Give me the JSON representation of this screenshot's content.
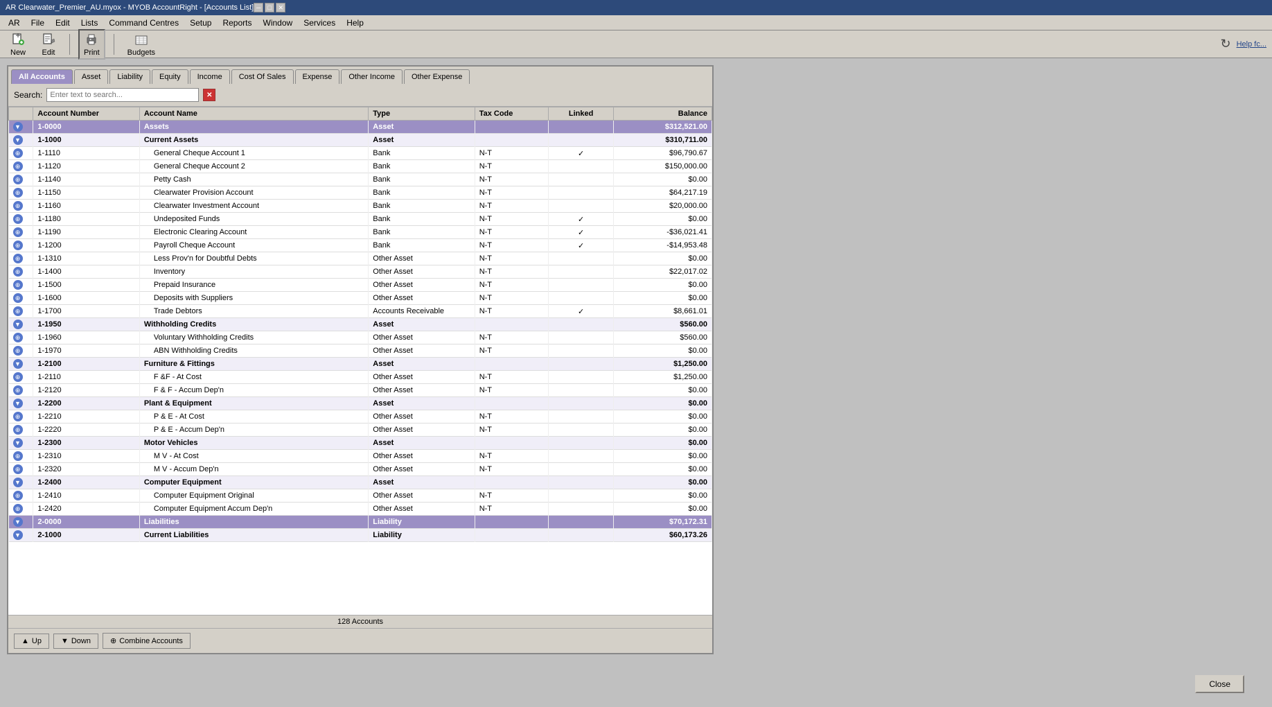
{
  "window": {
    "title": "AR Clearwater_Premier_AU.myox - MYOB AccountRight - [Accounts List]",
    "close_btn": "✕",
    "min_btn": "─",
    "max_btn": "□"
  },
  "menu": {
    "items": [
      "AR",
      "File",
      "Edit",
      "Lists",
      "Command Centres",
      "Setup",
      "Reports",
      "Window",
      "Services",
      "Help"
    ]
  },
  "toolbar": {
    "new_label": "New",
    "edit_label": "Edit",
    "print_label": "Print",
    "budgets_label": "Budgets"
  },
  "tabs": {
    "all_accounts": "All Accounts",
    "asset": "Asset",
    "liability": "Liability",
    "equity": "Equity",
    "income": "Income",
    "cost_of_sales": "Cost Of Sales",
    "expense": "Expense",
    "other_income": "Other Income",
    "other_expense": "Other Expense"
  },
  "search": {
    "label": "Search:",
    "placeholder": "Enter text to search..."
  },
  "table": {
    "headers": [
      "Account Number",
      "Account Name",
      "Type",
      "Tax Code",
      "Linked",
      "Balance"
    ],
    "rows": [
      {
        "num": "1-0000",
        "name": "Assets",
        "type": "Asset",
        "tax": "",
        "linked": "",
        "balance": "$312,521.00",
        "level": "group"
      },
      {
        "num": "1-1000",
        "name": "Current Assets",
        "type": "Asset",
        "tax": "",
        "linked": "",
        "balance": "$310,711.00",
        "level": "subgroup"
      },
      {
        "num": "1-1110",
        "name": "General Cheque Account 1",
        "type": "Bank",
        "tax": "N-T",
        "linked": "✓",
        "balance": "$96,790.67",
        "level": "item"
      },
      {
        "num": "1-1120",
        "name": "General Cheque Account 2",
        "type": "Bank",
        "tax": "N-T",
        "linked": "",
        "balance": "$150,000.00",
        "level": "item"
      },
      {
        "num": "1-1140",
        "name": "Petty Cash",
        "type": "Bank",
        "tax": "N-T",
        "linked": "",
        "balance": "$0.00",
        "level": "item"
      },
      {
        "num": "1-1150",
        "name": "Clearwater Provision Account",
        "type": "Bank",
        "tax": "N-T",
        "linked": "",
        "balance": "$64,217.19",
        "level": "item"
      },
      {
        "num": "1-1160",
        "name": "Clearwater Investment Account",
        "type": "Bank",
        "tax": "N-T",
        "linked": "",
        "balance": "$20,000.00",
        "level": "item"
      },
      {
        "num": "1-1180",
        "name": "Undeposited Funds",
        "type": "Bank",
        "tax": "N-T",
        "linked": "✓",
        "balance": "$0.00",
        "level": "item"
      },
      {
        "num": "1-1190",
        "name": "Electronic Clearing Account",
        "type": "Bank",
        "tax": "N-T",
        "linked": "✓",
        "balance": "-$36,021.41",
        "level": "item"
      },
      {
        "num": "1-1200",
        "name": "Payroll Cheque Account",
        "type": "Bank",
        "tax": "N-T",
        "linked": "✓",
        "balance": "-$14,953.48",
        "level": "item"
      },
      {
        "num": "1-1310",
        "name": "Less Prov'n for Doubtful Debts",
        "type": "Other Asset",
        "tax": "N-T",
        "linked": "",
        "balance": "$0.00",
        "level": "item"
      },
      {
        "num": "1-1400",
        "name": "Inventory",
        "type": "Other Asset",
        "tax": "N-T",
        "linked": "",
        "balance": "$22,017.02",
        "level": "item"
      },
      {
        "num": "1-1500",
        "name": "Prepaid Insurance",
        "type": "Other Asset",
        "tax": "N-T",
        "linked": "",
        "balance": "$0.00",
        "level": "item"
      },
      {
        "num": "1-1600",
        "name": "Deposits with Suppliers",
        "type": "Other Asset",
        "tax": "N-T",
        "linked": "",
        "balance": "$0.00",
        "level": "item"
      },
      {
        "num": "1-1700",
        "name": "Trade Debtors",
        "type": "Accounts Receivable",
        "tax": "N-T",
        "linked": "✓",
        "balance": "$8,661.01",
        "level": "item"
      },
      {
        "num": "1-1950",
        "name": "Withholding Credits",
        "type": "Asset",
        "tax": "",
        "linked": "",
        "balance": "$560.00",
        "level": "subgroup"
      },
      {
        "num": "1-1960",
        "name": "Voluntary Withholding Credits",
        "type": "Other Asset",
        "tax": "N-T",
        "linked": "",
        "balance": "$560.00",
        "level": "item"
      },
      {
        "num": "1-1970",
        "name": "ABN Withholding Credits",
        "type": "Other Asset",
        "tax": "N-T",
        "linked": "",
        "balance": "$0.00",
        "level": "item"
      },
      {
        "num": "1-2100",
        "name": "Furniture & Fittings",
        "type": "Asset",
        "tax": "",
        "linked": "",
        "balance": "$1,250.00",
        "level": "subgroup"
      },
      {
        "num": "1-2110",
        "name": "F &F  - At Cost",
        "type": "Other Asset",
        "tax": "N-T",
        "linked": "",
        "balance": "$1,250.00",
        "level": "item"
      },
      {
        "num": "1-2120",
        "name": "F & F - Accum  Dep'n",
        "type": "Other Asset",
        "tax": "N-T",
        "linked": "",
        "balance": "$0.00",
        "level": "item"
      },
      {
        "num": "1-2200",
        "name": "Plant & Equipment",
        "type": "Asset",
        "tax": "",
        "linked": "",
        "balance": "$0.00",
        "level": "subgroup"
      },
      {
        "num": "1-2210",
        "name": "P & E - At Cost",
        "type": "Other Asset",
        "tax": "N-T",
        "linked": "",
        "balance": "$0.00",
        "level": "item"
      },
      {
        "num": "1-2220",
        "name": "P & E - Accum Dep'n",
        "type": "Other Asset",
        "tax": "N-T",
        "linked": "",
        "balance": "$0.00",
        "level": "item"
      },
      {
        "num": "1-2300",
        "name": "Motor Vehicles",
        "type": "Asset",
        "tax": "",
        "linked": "",
        "balance": "$0.00",
        "level": "subgroup"
      },
      {
        "num": "1-2310",
        "name": "M V - At Cost",
        "type": "Other Asset",
        "tax": "N-T",
        "linked": "",
        "balance": "$0.00",
        "level": "item"
      },
      {
        "num": "1-2320",
        "name": "M V - Accum Dep'n",
        "type": "Other Asset",
        "tax": "N-T",
        "linked": "",
        "balance": "$0.00",
        "level": "item"
      },
      {
        "num": "1-2400",
        "name": "Computer Equipment",
        "type": "Asset",
        "tax": "",
        "linked": "",
        "balance": "$0.00",
        "level": "subgroup"
      },
      {
        "num": "1-2410",
        "name": "Computer Equipment Original",
        "type": "Other Asset",
        "tax": "N-T",
        "linked": "",
        "balance": "$0.00",
        "level": "item"
      },
      {
        "num": "1-2420",
        "name": "Computer Equipment Accum Dep'n",
        "type": "Other Asset",
        "tax": "N-T",
        "linked": "",
        "balance": "$0.00",
        "level": "item"
      },
      {
        "num": "2-0000",
        "name": "Liabilities",
        "type": "Liability",
        "tax": "",
        "linked": "",
        "balance": "$70,172.31",
        "level": "group"
      },
      {
        "num": "2-1000",
        "name": "Current Liabilities",
        "type": "Liability",
        "tax": "",
        "linked": "",
        "balance": "$60,173.26",
        "level": "subgroup"
      }
    ]
  },
  "status": {
    "account_count": "128 Accounts"
  },
  "bottom_buttons": {
    "up": "Up",
    "down": "Down",
    "combine_accounts": "Combine Accounts"
  },
  "footer": {
    "close": "Close"
  },
  "topright": {
    "help": "Help fc..."
  },
  "colors": {
    "group_bg": "#9b8fc4",
    "active_tab": "#9b8fc4",
    "toolbar_bg": "#d4d0c8"
  }
}
